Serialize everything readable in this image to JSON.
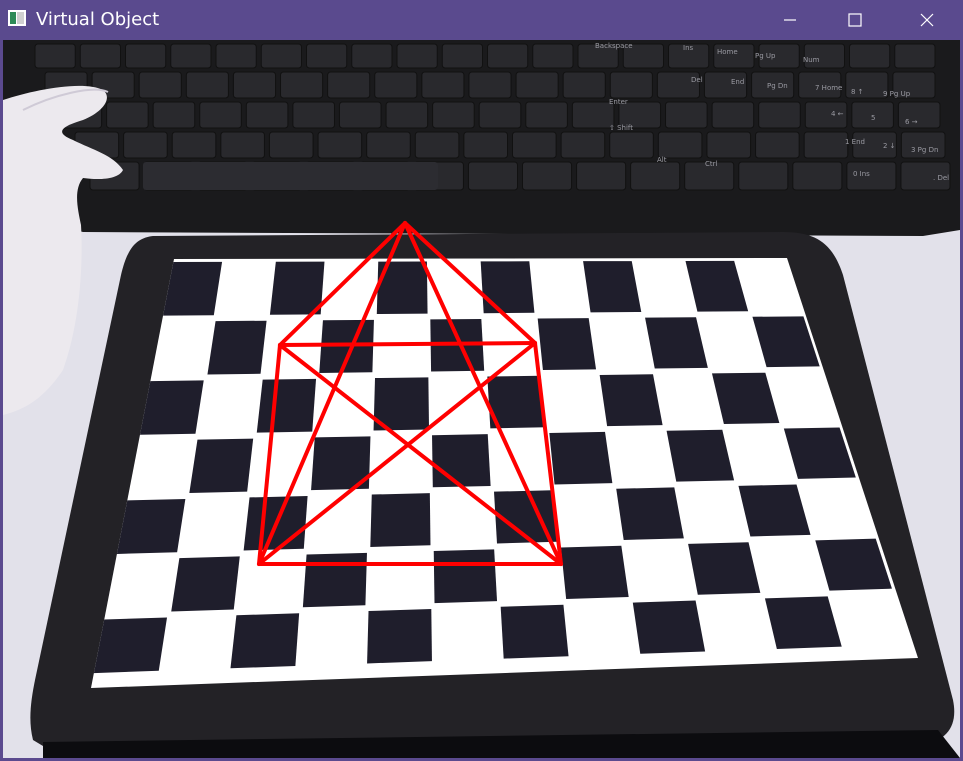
{
  "window": {
    "title": "Virtual Object",
    "icon": "opencv-window-icon",
    "controls": [
      {
        "name": "minimize",
        "icon": "minimize-icon"
      },
      {
        "name": "maximize",
        "icon": "maximize-icon"
      },
      {
        "name": "close",
        "icon": "close-icon"
      }
    ]
  },
  "keyboard_labels": [
    "Backspace",
    "Ins",
    "Home",
    "Pg Up",
    "Num",
    "Del",
    "End",
    "Pg Dn",
    "7 Home",
    "8 ↑",
    "9 Pg Up",
    "Enter",
    "⇧ Shift",
    "Alt",
    "Ctrl",
    "4 ←",
    "5",
    "6 →",
    "1 End",
    "2 ↓",
    "3 Pg Dn",
    "0 Ins",
    ". Del"
  ],
  "colors": {
    "titlebar": "#5a4a8e",
    "overlay": "#ff0000",
    "board_dark": "#1f1e2c",
    "board_light": "#ffffff",
    "tablet": "#232226",
    "keyboard": "#1a1a1c"
  }
}
